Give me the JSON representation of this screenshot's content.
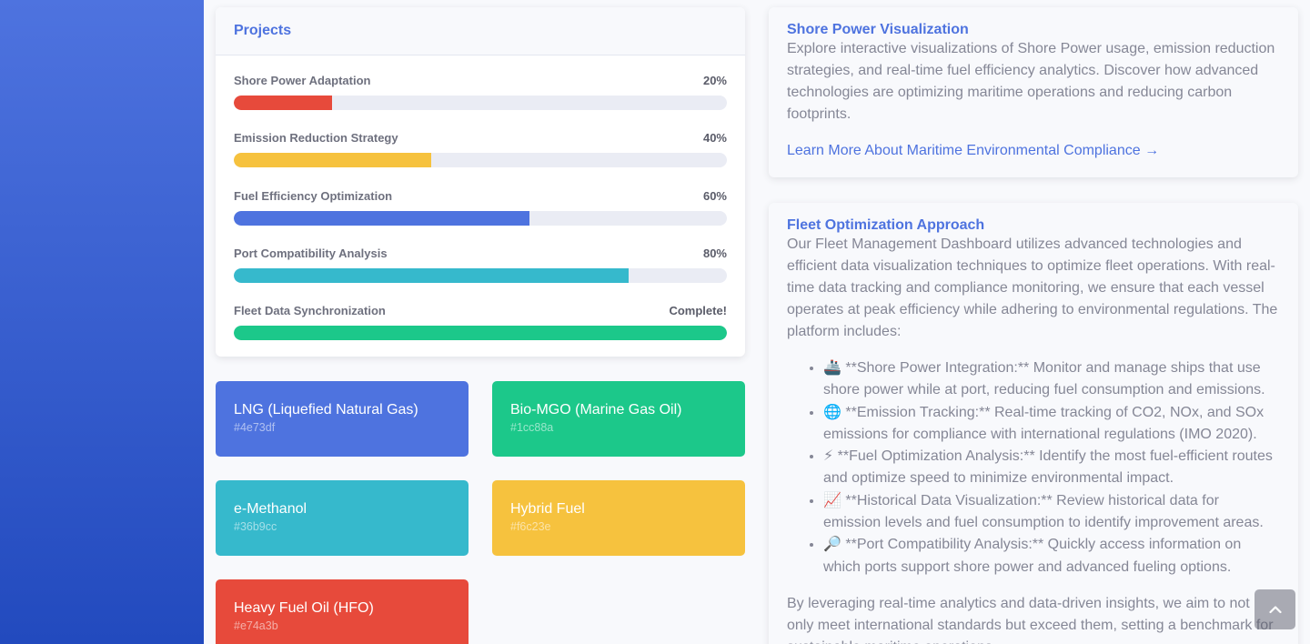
{
  "projects": {
    "title": "Projects",
    "items": [
      {
        "name": "Shore Power Adaptation",
        "status": "20%",
        "progress": 20,
        "color": "#e74a3b"
      },
      {
        "name": "Emission Reduction Strategy",
        "status": "40%",
        "progress": 40,
        "color": "#f6c23e"
      },
      {
        "name": "Fuel Efficiency Optimization",
        "status": "60%",
        "progress": 60,
        "color": "#4e73df"
      },
      {
        "name": "Port Compatibility Analysis",
        "status": "80%",
        "progress": 80,
        "color": "#36b9cc"
      },
      {
        "name": "Fleet Data Synchronization",
        "status": "Complete!",
        "progress": 100,
        "color": "#1cc88a"
      }
    ]
  },
  "fuels": [
    {
      "name": "LNG (Liquefied Natural Gas)",
      "hex": "#4e73df",
      "color": "#4e73df"
    },
    {
      "name": "Bio-MGO (Marine Gas Oil)",
      "hex": "#1cc88a",
      "color": "#1cc88a"
    },
    {
      "name": "e-Methanol",
      "hex": "#36b9cc",
      "color": "#36b9cc"
    },
    {
      "name": "Hybrid Fuel",
      "hex": "#f6c23e",
      "color": "#f6c23e"
    },
    {
      "name": "Heavy Fuel Oil (HFO)",
      "hex": "#e74a3b",
      "color": "#e74a3b"
    }
  ],
  "shore": {
    "title": "Shore Power Visualization",
    "text": "Explore interactive visualizations of Shore Power usage, emission reduction strategies, and real-time fuel efficiency analytics. Discover how advanced technologies are optimizing maritime operations and reducing carbon footprints.",
    "link": "Learn More About Maritime Environmental Compliance →"
  },
  "fleet": {
    "title": "Fleet Optimization Approach",
    "intro": "Our Fleet Management Dashboard utilizes advanced technologies and efficient data visualization techniques to optimize fleet operations. With real-time data tracking and compliance monitoring, we ensure that each vessel operates at peak efficiency while adhering to environmental regulations. The platform includes:",
    "features": [
      "🚢 **Shore Power Integration:** Monitor and manage ships that use shore power while at port, reducing fuel consumption and emissions.",
      "🌐 **Emission Tracking:** Real-time tracking of CO2, NOx, and SOx emissions for compliance with international regulations (IMO 2020).",
      "⚡ **Fuel Optimization Analysis:** Identify the most fuel-efficient routes and optimize speed to minimize environmental impact.",
      "📈 **Historical Data Visualization:** Review historical data for emission levels and fuel consumption to identify improvement areas.",
      "🔎 **Port Compatibility Analysis:** Quickly access information on which ports support shore power and advanced fueling options."
    ],
    "closing": "By leveraging real-time analytics and data-driven insights, we aim to not only meet international standards but exceed them, setting a benchmark for sustainable maritime operations."
  },
  "scroll_top_icon": "chevron-up-icon"
}
